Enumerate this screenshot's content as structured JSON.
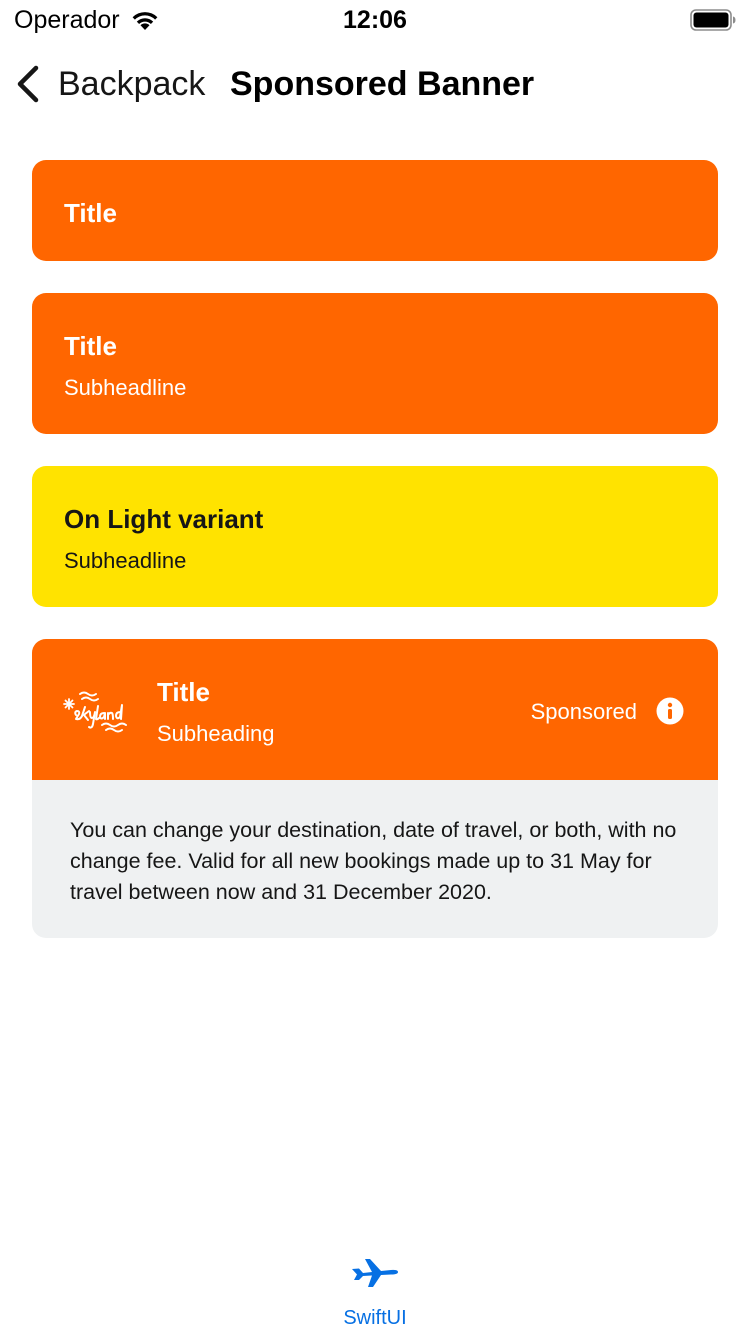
{
  "status_bar": {
    "carrier": "Operador",
    "time": "12:06"
  },
  "nav": {
    "back_label": "Backpack",
    "title": "Sponsored Banner"
  },
  "banners": [
    {
      "title": "Title",
      "variant": "on-dark",
      "background": "#ff6600"
    },
    {
      "title": "Title",
      "subheadline": "Subheadline",
      "variant": "on-dark",
      "background": "#ff6600"
    },
    {
      "title": "On Light variant",
      "subheadline": "Subheadline",
      "variant": "on-light",
      "background": "#ffe300"
    },
    {
      "logo_text": "skyland",
      "title": "Title",
      "subheadline": "Subheading",
      "callout": "Sponsored",
      "body": "You can change your destination, date of travel, or both, with no change fee. Valid for all new bookings made up to 31 May for travel between now and 31 December 2020.",
      "background": "#ff6600",
      "body_background": "#eff1f2"
    }
  ],
  "tab_bar": {
    "items": [
      {
        "label": "SwiftUI",
        "icon": "airplane-icon",
        "color": "#0770e3"
      }
    ]
  }
}
